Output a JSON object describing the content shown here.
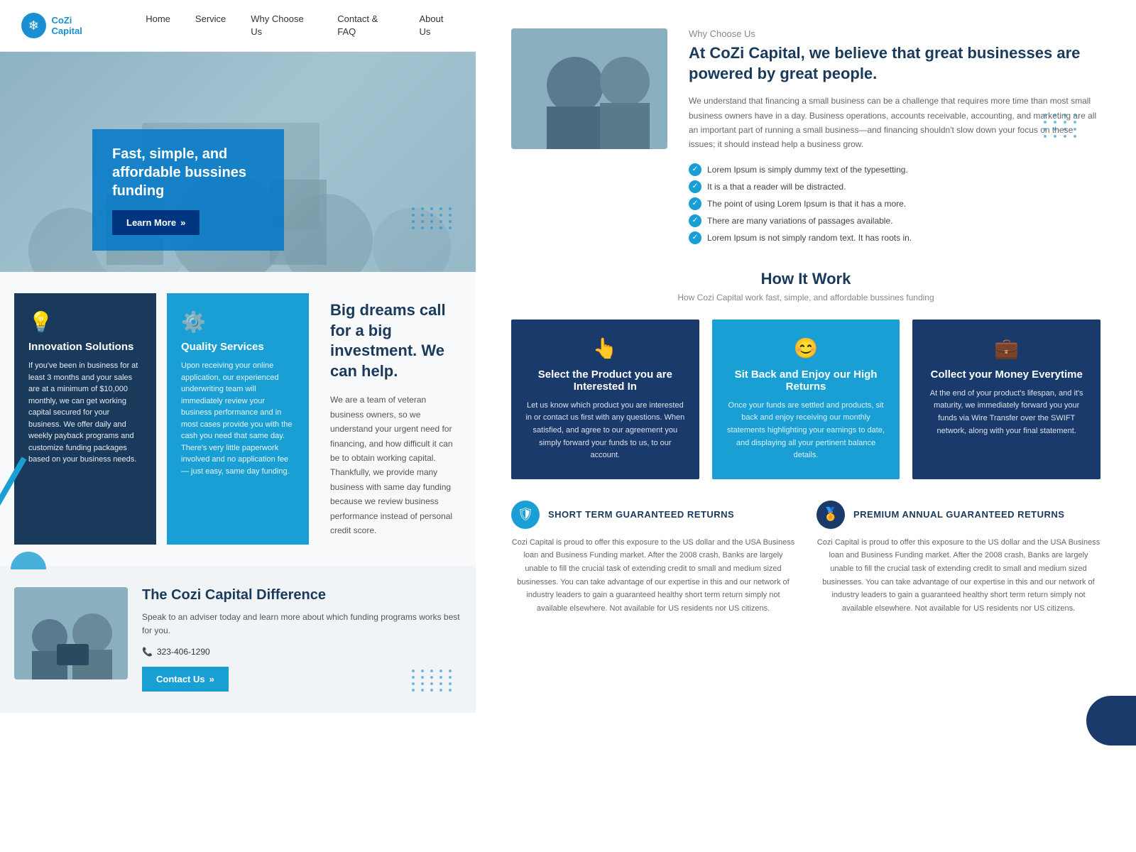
{
  "nav": {
    "logo_text": "CoZi Capital",
    "links": [
      "Home",
      "Service",
      "Why Choose Us",
      "Contact & FAQ",
      "About Us"
    ]
  },
  "hero": {
    "title": "Fast, simple, and affordable bussines funding",
    "btn_label": "Learn More",
    "btn_arrows": "»"
  },
  "features": {
    "card1_title": "Innovation Solutions",
    "card1_text": "If you've been in business for at least 3 months and your sales are at a minimum of $10,000 monthly, we can get working capital secured for your business. We offer daily and weekly payback programs and customize funding packages based on your business needs.",
    "card2_title": "Quality Services",
    "card2_text": "Upon receiving your online application, our experienced underwriting team will immediately review your business performance and in most cases provide you with the cash you need that same day. There's very little paperwork involved and no application fee — just easy, same day funding.",
    "main_title": "Big dreams call for a big investment. We can help.",
    "main_text": "We are a team of veteran business owners, so we understand your urgent need for financing, and how difficult it can be to obtain working capital. Thankfully, we provide many business with same day funding because we review business performance instead of personal credit score."
  },
  "bottom_left": {
    "title": "The Cozi Capital Difference",
    "text": "Speak to an adviser today and learn more about which funding programs works best for you.",
    "phone": "323-406-1290",
    "btn_label": "Contact Us",
    "btn_arrows": "»"
  },
  "why": {
    "label": "Why Choose Us",
    "title": "At CoZi Capital, we believe that great businesses are powered by great people.",
    "text": "We understand that financing a small business can be a challenge that requires more time than most small business owners have in a day. Business operations, accounts receivable, accounting, and marketing are all an important part of running a small business—and financing shouldn't slow down your focus on these issues; it should instead help a business grow.",
    "list": [
      "Lorem Ipsum is simply dummy text of the typesetting.",
      "It is a that a reader will be distracted.",
      "The point of using Lorem Ipsum is that it has a more.",
      "There are many variations of passages available.",
      "Lorem Ipsum is not simply random text. It has roots in."
    ]
  },
  "how": {
    "title": "How It Work",
    "subtitle": "How Cozi Capital work fast, simple, and affordable bussines funding",
    "cards": [
      {
        "icon": "👆",
        "title": "Select the Product you are Interested In",
        "text": "Let us know which product you are interested in or contact us first with any questions. When satisfied, and agree to our agreement you simply forward your funds to us, to our account."
      },
      {
        "icon": "😊",
        "title": "Sit Back and Enjoy our High Returns",
        "text": "Once your funds are settled and products, sit back and enjoy receiving our monthly statements highlighting your earnings to date, and displaying all your pertinent balance details."
      },
      {
        "icon": "💼",
        "title": "Collect your Money Everytime",
        "text": "At the end of your product's lifespan, and it's maturity, we immediately forward you your funds via Wire Transfer over the SWIFT network, along with your final statement."
      }
    ]
  },
  "returns": {
    "item1_title": "SHORT TERM GUARANTEED RETURNS",
    "item1_text": "Cozi Capital is proud to offer this exposure to the US dollar and the USA Business loan and Business Funding market. After the 2008 crash, Banks are largely unable to fill the crucial task of extending credit to small and medium sized businesses. You can take advantage of our expertise in this and our network of industry leaders to gain a guaranteed healthy short term return simply not available elsewhere. Not available for US residents nor US citizens.",
    "item2_title": "PREMIUM ANNUAL GUARANTEED RETURNS",
    "item2_text": "Cozi Capital is proud to offer this exposure to the US dollar and the USA Business loan and Business Funding market. After the 2008 crash, Banks are largely unable to fill the crucial task of extending credit to small and medium sized businesses. You can take advantage of our expertise in this and our network of industry leaders to gain a guaranteed healthy short term return simply not available elsewhere. Not available for US residents nor US citizens."
  }
}
